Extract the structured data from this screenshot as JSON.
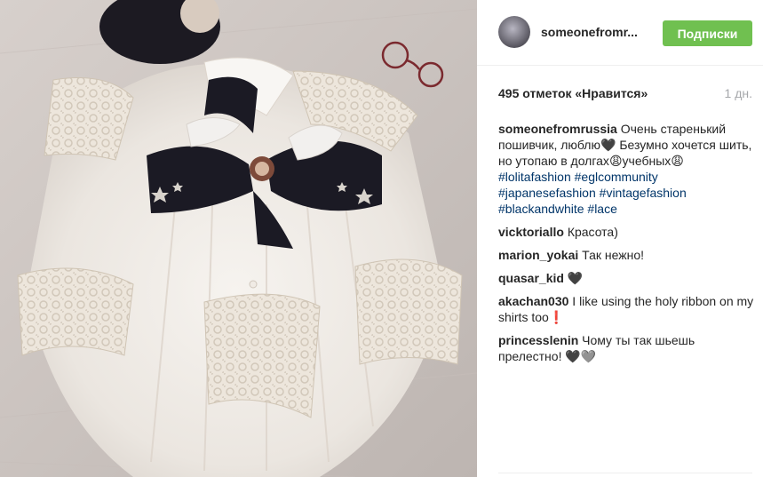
{
  "post": {
    "username": "someonefromr...",
    "follow_label": "Подписки",
    "likes": "495 отметок «Нравится»",
    "time": "1 дн.",
    "caption": {
      "user": "someonefromrussia",
      "text_1": "Очень старенький пошивчик, люблю",
      "heart": "🖤",
      "text_2": "Безумно хочется шить, но утопаю в долгах",
      "emoji_1": "😩",
      "text_3": "учебных",
      "emoji_2": "😩",
      "tags": [
        "#lolitafashion",
        "#eglcommunity",
        "#japanesefashion",
        "#vintagefashion",
        "#blackandwhite",
        "#lace"
      ]
    },
    "comments": [
      {
        "user": "vicktoriallo",
        "text": "Красота)"
      },
      {
        "user": "marion_yokai",
        "text": "Так нежно!"
      },
      {
        "user": "quasar_kid",
        "text": "🖤"
      },
      {
        "user": "akachan030",
        "text": "I like using the holy ribbon on my shirts too❗"
      },
      {
        "user": "princesslenin",
        "text": "Чому ты так шьешь прелестно! 🖤🩶"
      }
    ]
  },
  "colors": {
    "follow_button": "#70c050",
    "hashtag": "#003569",
    "timestamp": "#a5a7aa"
  },
  "icons": {
    "avatar": "avatar"
  }
}
